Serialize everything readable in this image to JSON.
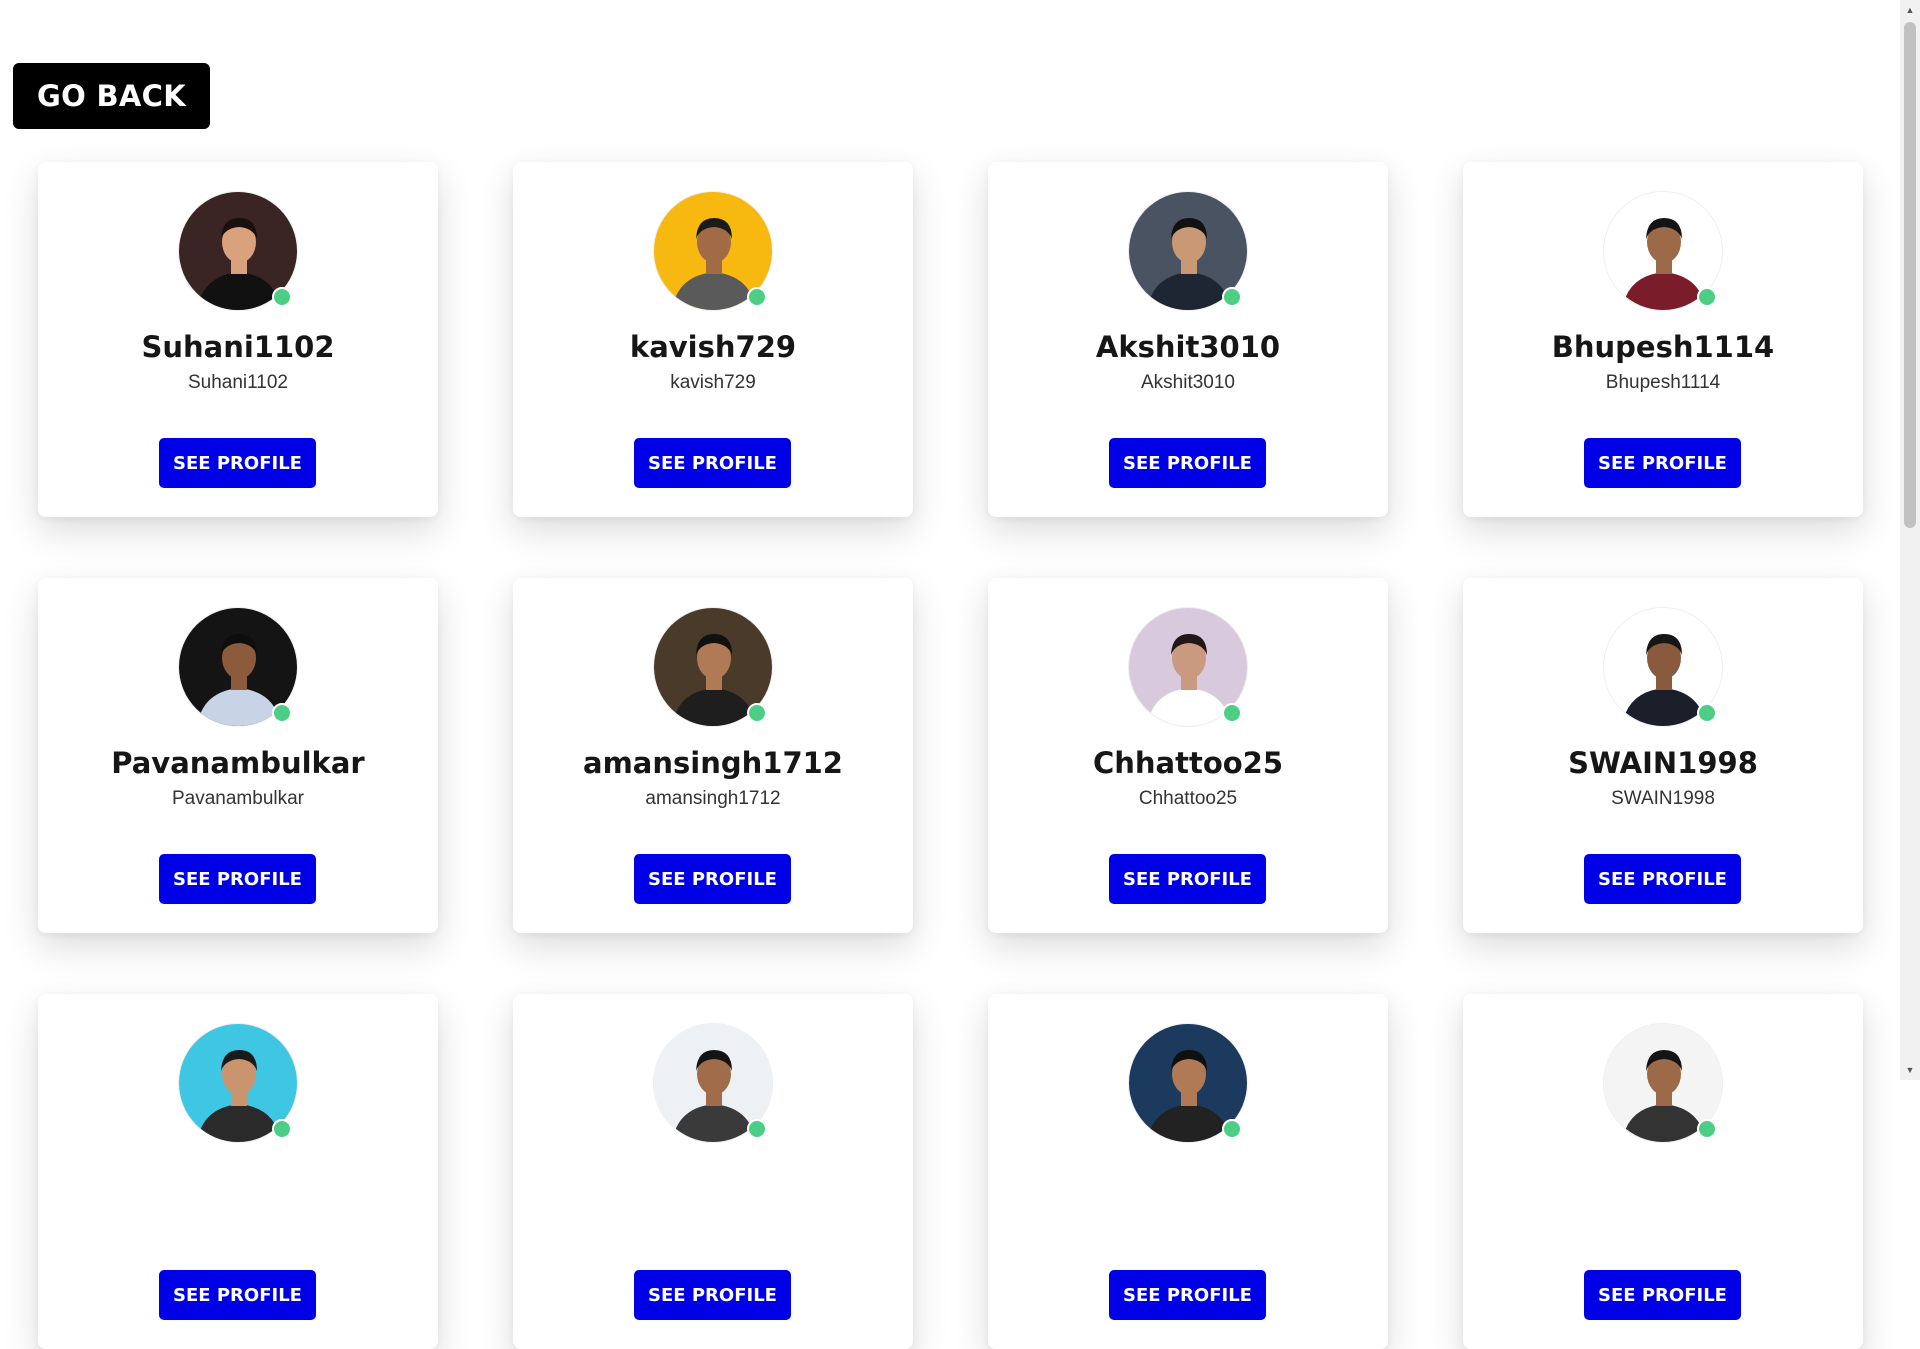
{
  "go_back_label": "GO BACK",
  "see_profile_label": "SEE PROFILE",
  "accent_color": "#0000e6",
  "online_color": "#4ccf84",
  "users": [
    {
      "name": "Suhani1102",
      "handle": "Suhani1102",
      "avatar_bg": "#3a2424",
      "skin": "#d9a27c",
      "hair": "#1a1010",
      "shirt": "#111111"
    },
    {
      "name": "kavish729",
      "handle": "kavish729",
      "avatar_bg": "#f7b80f",
      "skin": "#a36b45",
      "hair": "#1b1b1b",
      "shirt": "#5a5a5a"
    },
    {
      "name": "Akshit3010",
      "handle": "Akshit3010",
      "avatar_bg": "#4a5362",
      "skin": "#c99874",
      "hair": "#111111",
      "shirt": "#1f2633"
    },
    {
      "name": "Bhupesh1114",
      "handle": "Bhupesh1114",
      "avatar_bg": "#ffffff",
      "skin": "#9c6a48",
      "hair": "#141414",
      "shirt": "#7a1c2a"
    },
    {
      "name": "Pavanambulkar",
      "handle": "Pavanambulkar",
      "avatar_bg": "#141414",
      "skin": "#8c5b3c",
      "hair": "#0d0d0d",
      "shirt": "#c8d3e6"
    },
    {
      "name": "amansingh1712",
      "handle": "amansingh1712",
      "avatar_bg": "#4a3a2a",
      "skin": "#b07a55",
      "hair": "#111111",
      "shirt": "#1e1e1e"
    },
    {
      "name": "Chhattoo25",
      "handle": "Chhattoo25",
      "avatar_bg": "#d8c9dc",
      "skin": "#c99a80",
      "hair": "#221616",
      "shirt": "#ffffff"
    },
    {
      "name": "SWAIN1998",
      "handle": "SWAIN1998",
      "avatar_bg": "#ffffff",
      "skin": "#8a5a3e",
      "hair": "#161616",
      "shirt": "#1a1f2a"
    },
    {
      "name": "",
      "handle": "",
      "avatar_bg": "#3fc6e3",
      "skin": "#c9946e",
      "hair": "#1a1a1a",
      "shirt": "#2a2a2a"
    },
    {
      "name": "",
      "handle": "",
      "avatar_bg": "#eef1f4",
      "skin": "#a06c4a",
      "hair": "#141414",
      "shirt": "#3a3a3a"
    },
    {
      "name": "",
      "handle": "",
      "avatar_bg": "#1c3a5e",
      "skin": "#b07a55",
      "hair": "#101010",
      "shirt": "#222222"
    },
    {
      "name": "",
      "handle": "",
      "avatar_bg": "#f4f4f4",
      "skin": "#9c6a48",
      "hair": "#141414",
      "shirt": "#333333"
    }
  ]
}
